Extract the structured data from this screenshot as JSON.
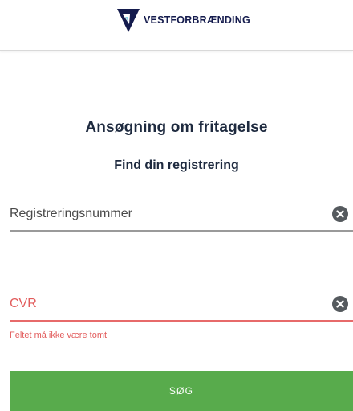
{
  "header": {
    "brand_name": "VESTFORBRÆNDING",
    "logo_icon": "vestforbraending-v-logo",
    "brand_color": "#141b4d"
  },
  "main": {
    "title": "Ansøgning om fritagelse",
    "subtitle": "Find din registrering"
  },
  "form": {
    "registration_field": {
      "placeholder": "Registreringsnummer",
      "value": "",
      "clear_icon": "clear-icon"
    },
    "cvr_field": {
      "placeholder": "CVR",
      "value": "",
      "clear_icon": "clear-icon",
      "error": "Feltet må ikke være tomt"
    },
    "submit_label": "SØG"
  },
  "colors": {
    "error": "#e25c5c",
    "button": "#58ab4c",
    "heading": "#1e2a3f"
  }
}
